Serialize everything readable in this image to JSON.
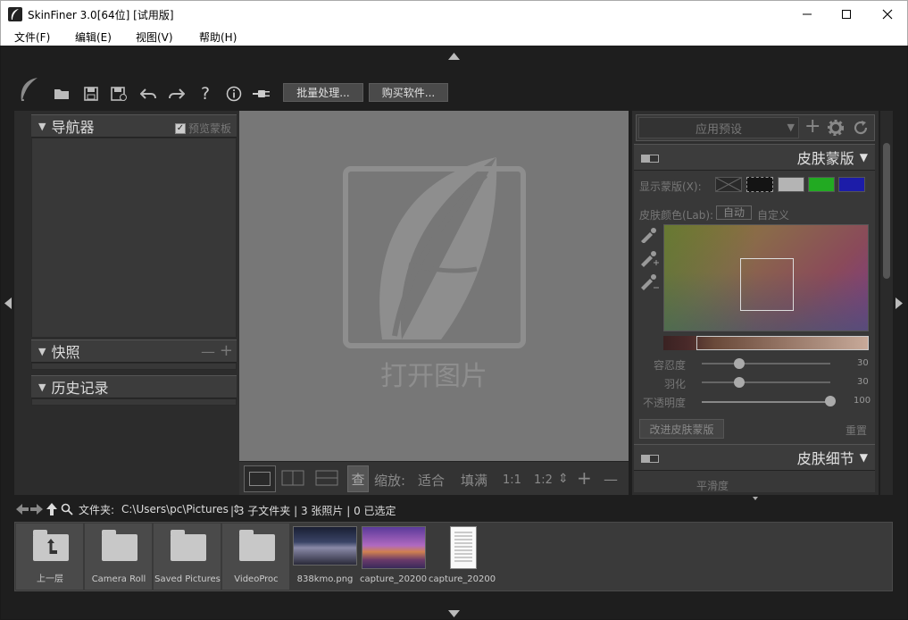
{
  "window": {
    "title": "SkinFiner 3.0[64位] [试用版]",
    "minimize": "—",
    "maximize": "☐",
    "close": "✕"
  },
  "menu": [
    "文件(F)",
    "编辑(E)",
    "视图(V)",
    "帮助(H)"
  ],
  "toolbar": {
    "batch_label": "批量处理...",
    "buy_label": "购买软件..."
  },
  "left_panels": {
    "navigator": {
      "title": "导航器",
      "preview_mask_label": "预览蒙板",
      "preview_mask_checked": true
    },
    "snapshot": {
      "title": "快照",
      "minus": "—",
      "plus": "+"
    },
    "history": {
      "title": "历史记录"
    }
  },
  "canvas": {
    "open_label": "打开图片"
  },
  "zoom_bar": {
    "separate": "查",
    "zoom_label": "缩放:",
    "fit": "适合",
    "fill": "填满",
    "ratio_1_1": "1:1",
    "ratio_1_2": "1:2",
    "spinner": "⇕",
    "plus": "+",
    "minus": "—"
  },
  "right_panel": {
    "preset_placeholder": "应用预设",
    "skin_mask": {
      "title": "皮肤蒙版",
      "show_mask_label": "显示蒙版(X):",
      "swatch_colors": [
        "#2a2a2a",
        "#141414",
        "#b4b4b4",
        "#22aa22",
        "#1c1ca8"
      ],
      "skin_color_label": "皮肤颜色(Lab):",
      "auto_label": "自动",
      "custom_label": "自定义",
      "sliders": [
        {
          "label": "容忍度",
          "value": 30
        },
        {
          "label": "羽化",
          "value": 30
        },
        {
          "label": "不透明度",
          "value": 100
        }
      ],
      "improve_label": "改进皮肤蒙版",
      "reset_label": "重置"
    },
    "skin_detail": {
      "title": "皮肤细节",
      "smoothness_label": "平滑度"
    }
  },
  "pathbar": {
    "folder_label": "文件夹:",
    "path": "C:\\Users\\pc\\Pictures ⇕",
    "summary": "| 3 子文件夹 | 3 张照片 | 0 已选定"
  },
  "filmstrip": [
    {
      "label": "上一层",
      "kind": "up"
    },
    {
      "label": "Camera Roll",
      "kind": "folder"
    },
    {
      "label": "Saved Pictures",
      "kind": "folder"
    },
    {
      "label": "VideoProc",
      "kind": "folder"
    },
    {
      "label": "838kmo.png",
      "kind": "image-city"
    },
    {
      "label": "capture_20200...",
      "kind": "image-palace"
    },
    {
      "label": "capture_20200...",
      "kind": "image-doc"
    }
  ],
  "icons": {
    "logo": "feather-icon",
    "open": "folder-open-icon",
    "save": "save-icon",
    "save_as": "save-as-icon",
    "undo": "undo-icon",
    "redo": "redo-icon",
    "help": "question-icon",
    "info": "info-icon",
    "plugin": "plug-icon"
  }
}
